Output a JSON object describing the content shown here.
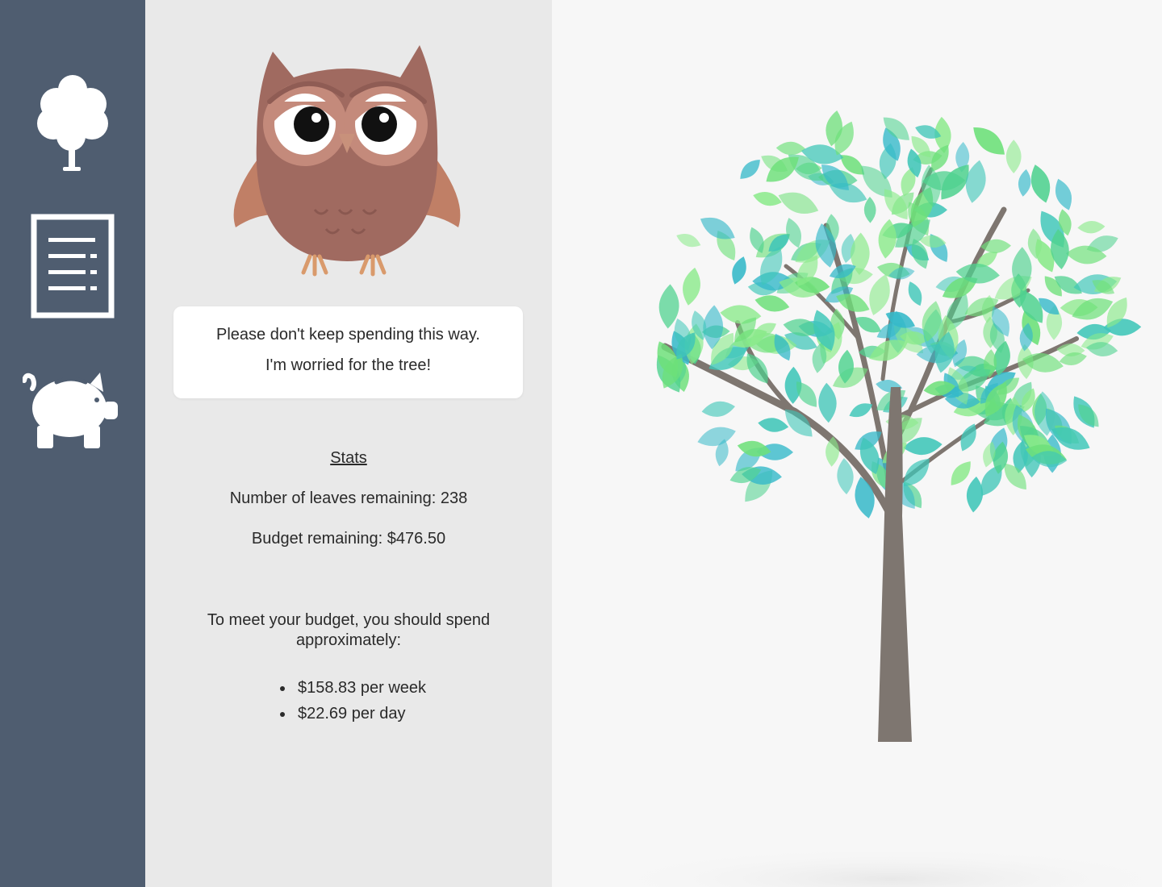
{
  "sidebar": {
    "items": [
      {
        "icon": "tree-icon"
      },
      {
        "icon": "document-list-icon"
      },
      {
        "icon": "piggy-bank-icon"
      }
    ]
  },
  "owl": {
    "message_line1": "Please don't keep spending this way.",
    "message_line2": "I'm worried for the tree!"
  },
  "stats": {
    "heading": "Stats",
    "leaves_line": "Number of leaves remaining: 238",
    "budget_line": "Budget remaining: $476.50",
    "advice": "To meet your budget, you should spend approximately:",
    "per_week": "$158.83 per week",
    "per_day": "$22.69 per day"
  },
  "colors": {
    "sidebar": "#4f5d70",
    "panel": "#e9e9e9",
    "owl_body": "#a06a60",
    "leaf_green": "#6ee07a",
    "leaf_teal": "#3fc6b8",
    "trunk": "#7e7670"
  }
}
